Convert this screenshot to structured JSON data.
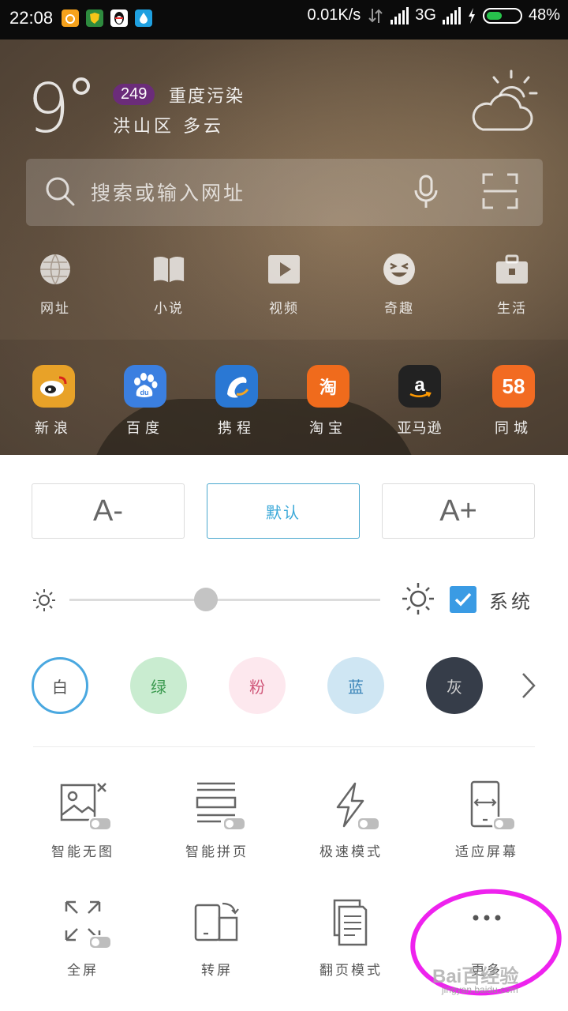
{
  "status_bar": {
    "time": "22:08",
    "speed": "0.01K/s",
    "network": "3G",
    "battery": "48%",
    "battery_level": 0.48
  },
  "weather": {
    "temperature": "9",
    "aqi_value": "249",
    "aqi_label": "重度污染",
    "location": "洪山区 多云"
  },
  "search": {
    "placeholder": "搜索或输入网址"
  },
  "quick_nav": [
    {
      "label": "网址",
      "icon": "globe-icon"
    },
    {
      "label": "小说",
      "icon": "book-icon"
    },
    {
      "label": "视频",
      "icon": "play-icon"
    },
    {
      "label": "奇趣",
      "icon": "laugh-face-icon"
    },
    {
      "label": "生活",
      "icon": "briefcase-icon"
    }
  ],
  "sites": [
    {
      "label": "新浪",
      "logo": "",
      "color": "#e8a228"
    },
    {
      "label": "百度",
      "logo": "du",
      "color": "#3b7fe0"
    },
    {
      "label": "携程",
      "logo": "",
      "color": "#2a78d4"
    },
    {
      "label": "淘宝",
      "logo": "淘",
      "color": "#f06b1c"
    },
    {
      "label": "亚马逊",
      "logo": "a",
      "color": "#222222"
    },
    {
      "label": "同城",
      "logo": "58",
      "color": "#f26b22"
    }
  ],
  "font_size": {
    "decrease": "A-",
    "default": "默认",
    "increase": "A+"
  },
  "brightness": {
    "level": 0.44,
    "system_label": "系统",
    "system_checked": true
  },
  "themes": [
    {
      "label": "白",
      "bg": "#ffffff",
      "fg": "#555555",
      "selected": true
    },
    {
      "label": "绿",
      "bg": "#c9ecd0",
      "fg": "#3c9a50"
    },
    {
      "label": "粉",
      "bg": "#fde8ee",
      "fg": "#d0587a"
    },
    {
      "label": "蓝",
      "bg": "#cfe6f3",
      "fg": "#3a84b8"
    },
    {
      "label": "灰",
      "bg": "#363d49",
      "fg": "#d0d0d0"
    }
  ],
  "tools": [
    {
      "label": "智能无图",
      "icon": "no-image-icon"
    },
    {
      "label": "智能拼页",
      "icon": "page-merge-icon"
    },
    {
      "label": "极速模式",
      "icon": "lightning-icon"
    },
    {
      "label": "适应屏幕",
      "icon": "fit-screen-icon"
    },
    {
      "label": "全屏",
      "icon": "fullscreen-icon"
    },
    {
      "label": "转屏",
      "icon": "rotate-screen-icon"
    },
    {
      "label": "翻页模式",
      "icon": "page-turn-icon"
    },
    {
      "label": "更多",
      "icon": "more-dots-icon"
    }
  ],
  "watermark": {
    "text": "Bai百经验",
    "url": "jingyan.baidu.com"
  }
}
